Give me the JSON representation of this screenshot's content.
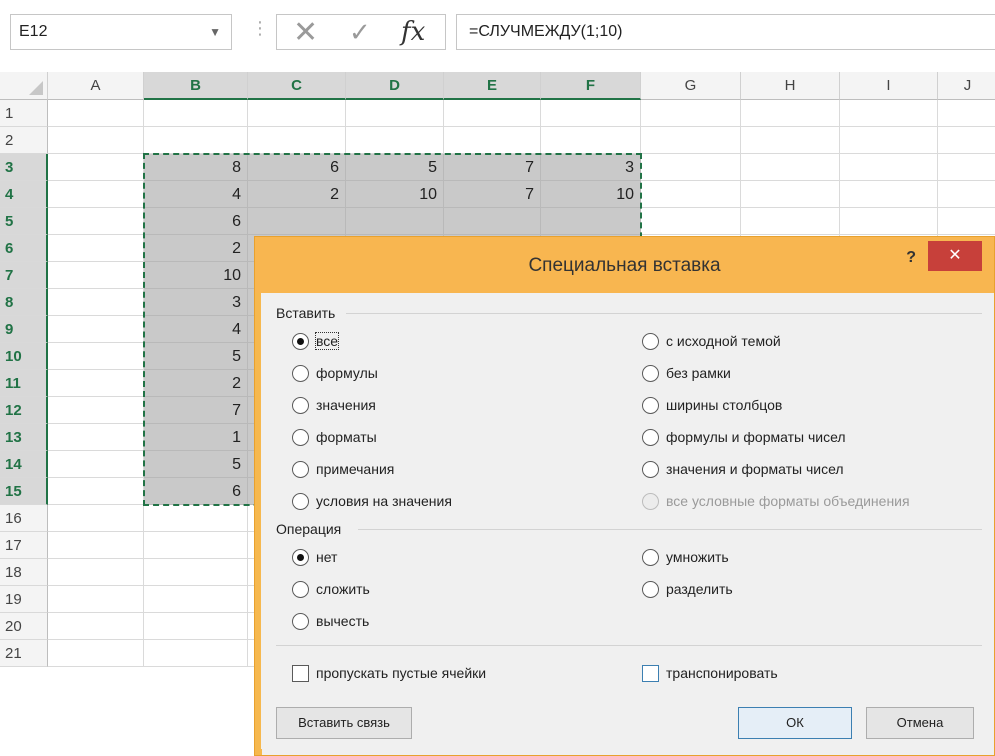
{
  "formula_bar": {
    "name_box": "E12",
    "name_box_arrow": "▼",
    "separator": "⋮",
    "cancel_glyph": "✕",
    "enter_glyph": "✓",
    "fx_glyph": "fx",
    "formula": "=СЛУЧМЕЖДУ(1;10)"
  },
  "grid": {
    "columns": [
      "A",
      "B",
      "C",
      "D",
      "E",
      "F",
      "G",
      "H",
      "I",
      "J"
    ],
    "selected_columns": [
      "B",
      "C",
      "D",
      "E",
      "F"
    ],
    "rows": [
      "1",
      "2",
      "3",
      "4",
      "5",
      "6",
      "7",
      "8",
      "9",
      "10",
      "11",
      "12",
      "13",
      "14",
      "15",
      "16",
      "17",
      "18",
      "19",
      "20",
      "21"
    ],
    "selected_rows": [
      "3",
      "4",
      "5",
      "6",
      "7",
      "8",
      "9",
      "10",
      "11",
      "12",
      "13",
      "14",
      "15"
    ],
    "data": {
      "row3": [
        "8",
        "6",
        "5",
        "7",
        "3"
      ],
      "row4": [
        "4",
        "2",
        "10",
        "7",
        "10"
      ],
      "row5": [
        "6",
        "",
        "",
        "",
        ""
      ],
      "row6": [
        "2",
        "",
        "",
        "",
        ""
      ],
      "row7": [
        "10",
        "",
        "",
        "",
        ""
      ],
      "row8": [
        "3",
        "",
        "",
        "",
        ""
      ],
      "row9": [
        "4",
        "",
        "",
        "",
        ""
      ],
      "row10": [
        "5",
        "",
        "",
        "",
        ""
      ],
      "row11": [
        "2",
        "",
        "",
        "",
        ""
      ],
      "row12": [
        "7",
        "",
        "",
        "",
        ""
      ],
      "row13": [
        "1",
        "",
        "",
        "",
        ""
      ],
      "row14": [
        "5",
        "",
        "",
        "",
        ""
      ],
      "row15": [
        "6",
        "",
        "",
        "",
        ""
      ]
    }
  },
  "dialog": {
    "title": "Специальная вставка",
    "help": "?",
    "close": "✕",
    "paste_group": "Вставить",
    "paste_options_left": [
      "все",
      "формулы",
      "значения",
      "форматы",
      "примечания",
      "условия на значения"
    ],
    "paste_options_right": [
      "с исходной темой",
      "без рамки",
      "ширины столбцов",
      "формулы и форматы чисел",
      "значения и форматы чисел",
      "все условные форматы объединения"
    ],
    "paste_selected": "все",
    "operation_group": "Операция",
    "operation_left": [
      "нет",
      "сложить",
      "вычесть"
    ],
    "operation_right": [
      "умножить",
      "разделить"
    ],
    "operation_selected": "нет",
    "skip_blanks": "пропускать пустые ячейки",
    "transpose": "транспонировать",
    "paste_link_button": "Вставить связь",
    "ok_button": "ОК",
    "cancel_button": "Отмена"
  }
}
